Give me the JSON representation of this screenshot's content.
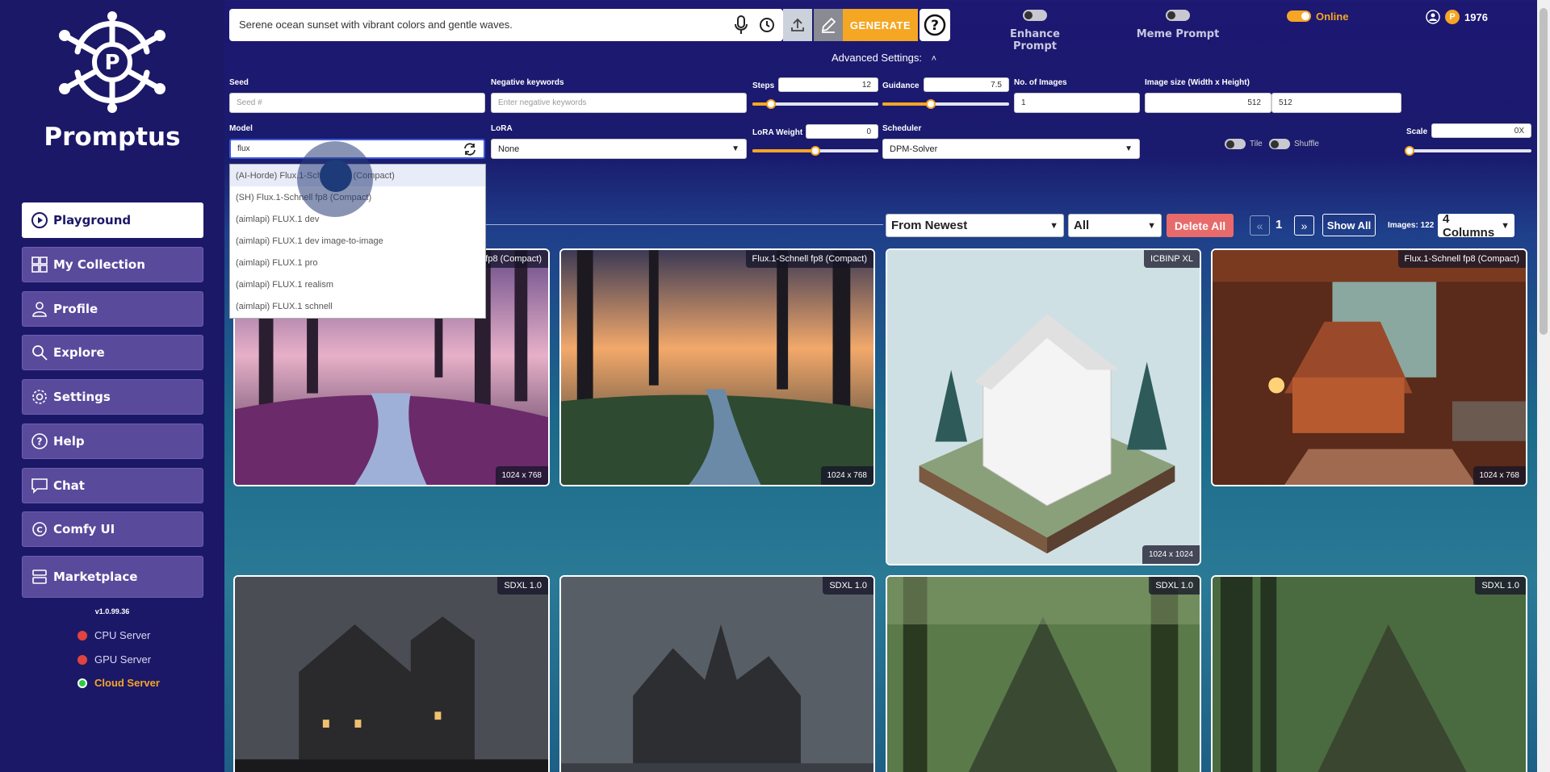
{
  "brand": "Promptus",
  "sidebar": {
    "items": [
      {
        "label": "Playground",
        "icon": "play-circle-icon"
      },
      {
        "label": "My Collection",
        "icon": "grid-icon"
      },
      {
        "label": "Profile",
        "icon": "user-icon"
      },
      {
        "label": "Explore",
        "icon": "search-icon"
      },
      {
        "label": "Settings",
        "icon": "gear-icon"
      },
      {
        "label": "Help",
        "icon": "question-icon"
      },
      {
        "label": "Chat",
        "icon": "chat-icon"
      },
      {
        "label": "Comfy UI",
        "icon": "comfy-icon"
      },
      {
        "label": "Marketplace",
        "icon": "store-icon"
      }
    ],
    "version": "v1.0.99.36",
    "servers": [
      {
        "label": "CPU Server",
        "status_color": "#e0443f"
      },
      {
        "label": "GPU Server",
        "status_color": "#e0443f"
      },
      {
        "label": "Cloud Server",
        "status_color": "#2ecc40"
      }
    ]
  },
  "topbar": {
    "prompt": "Serene ocean sunset with vibrant colors and gentle waves.",
    "generate_label": "GENERATE",
    "enhance_label": "Enhance Prompt",
    "meme_label": "Meme Prompt",
    "online_label": "Online",
    "credits": "1976",
    "advanced_label": "Advanced Settings:"
  },
  "settings": {
    "seed_label": "Seed",
    "seed_placeholder": "Seed #",
    "neg_label": "Negative keywords",
    "neg_placeholder": "Enter negative keywords",
    "steps_label": "Steps",
    "steps_value": "12",
    "steps_level": 0.15,
    "guidance_label": "Guidance",
    "guidance_value": "7.5",
    "guidance_level": 0.38,
    "images_label": "No. of Images",
    "images_value": "1",
    "size_label": "Image size (Width x Height)",
    "width_value": "512",
    "height_value": "512",
    "model_label": "Model",
    "model_value": "flux",
    "lora_label": "LoRA",
    "lora_value": "None",
    "lora_weight_label": "LoRA Weight",
    "lora_weight_value": "0",
    "lora_weight_level": 0.5,
    "scheduler_label": "Scheduler",
    "scheduler_value": "DPM-Solver",
    "tile_label": "Tile",
    "shuffle_label": "Shuffle",
    "scale_label": "Scale",
    "scale_value": "0X",
    "scale_level": 0.0
  },
  "model_dropdown": [
    "(AI-Horde) Flux.1-Schnell fp8 (Compact)",
    "(SH) Flux.1-Schnell fp8 (Compact)",
    "(aimlapi) FLUX.1 dev",
    "(aimlapi) FLUX.1 dev image-to-image",
    "(aimlapi) FLUX.1 pro",
    "(aimlapi) FLUX.1 realism",
    "(aimlapi) FLUX.1 schnell"
  ],
  "gallery": {
    "sort_value": "From Newest",
    "filter_value": "All",
    "delete_label": "Delete All",
    "page": "1",
    "show_all_label": "Show All",
    "images_count": "Images: 122",
    "columns_value": "4 Columns",
    "cards": [
      {
        "tag": "fp8 (Compact)",
        "size": "1024 x 768",
        "scene": "forest-stream"
      },
      {
        "tag": "Flux.1-Schnell fp8 (Compact)",
        "size": "1024 x 768",
        "scene": "forest-stream"
      },
      {
        "tag": "ICBINP XL",
        "size": "1024 x 1024",
        "scene": "paper-house"
      },
      {
        "tag": "Flux.1-Schnell fp8 (Compact)",
        "size": "1024 x 768",
        "scene": "cozy-room"
      },
      {
        "tag": "SDXL 1.0",
        "size": "",
        "scene": "dark-house"
      },
      {
        "tag": "SDXL 1.0",
        "size": "",
        "scene": "dark-house"
      },
      {
        "tag": "SDXL 1.0",
        "size": "",
        "scene": "jungle-temple"
      },
      {
        "tag": "SDXL 1.0",
        "size": "",
        "scene": "jungle-temple"
      }
    ]
  },
  "colors": {
    "accent": "#f5a623",
    "sidebar": "#1c1868",
    "delete": "#e86a6a"
  }
}
